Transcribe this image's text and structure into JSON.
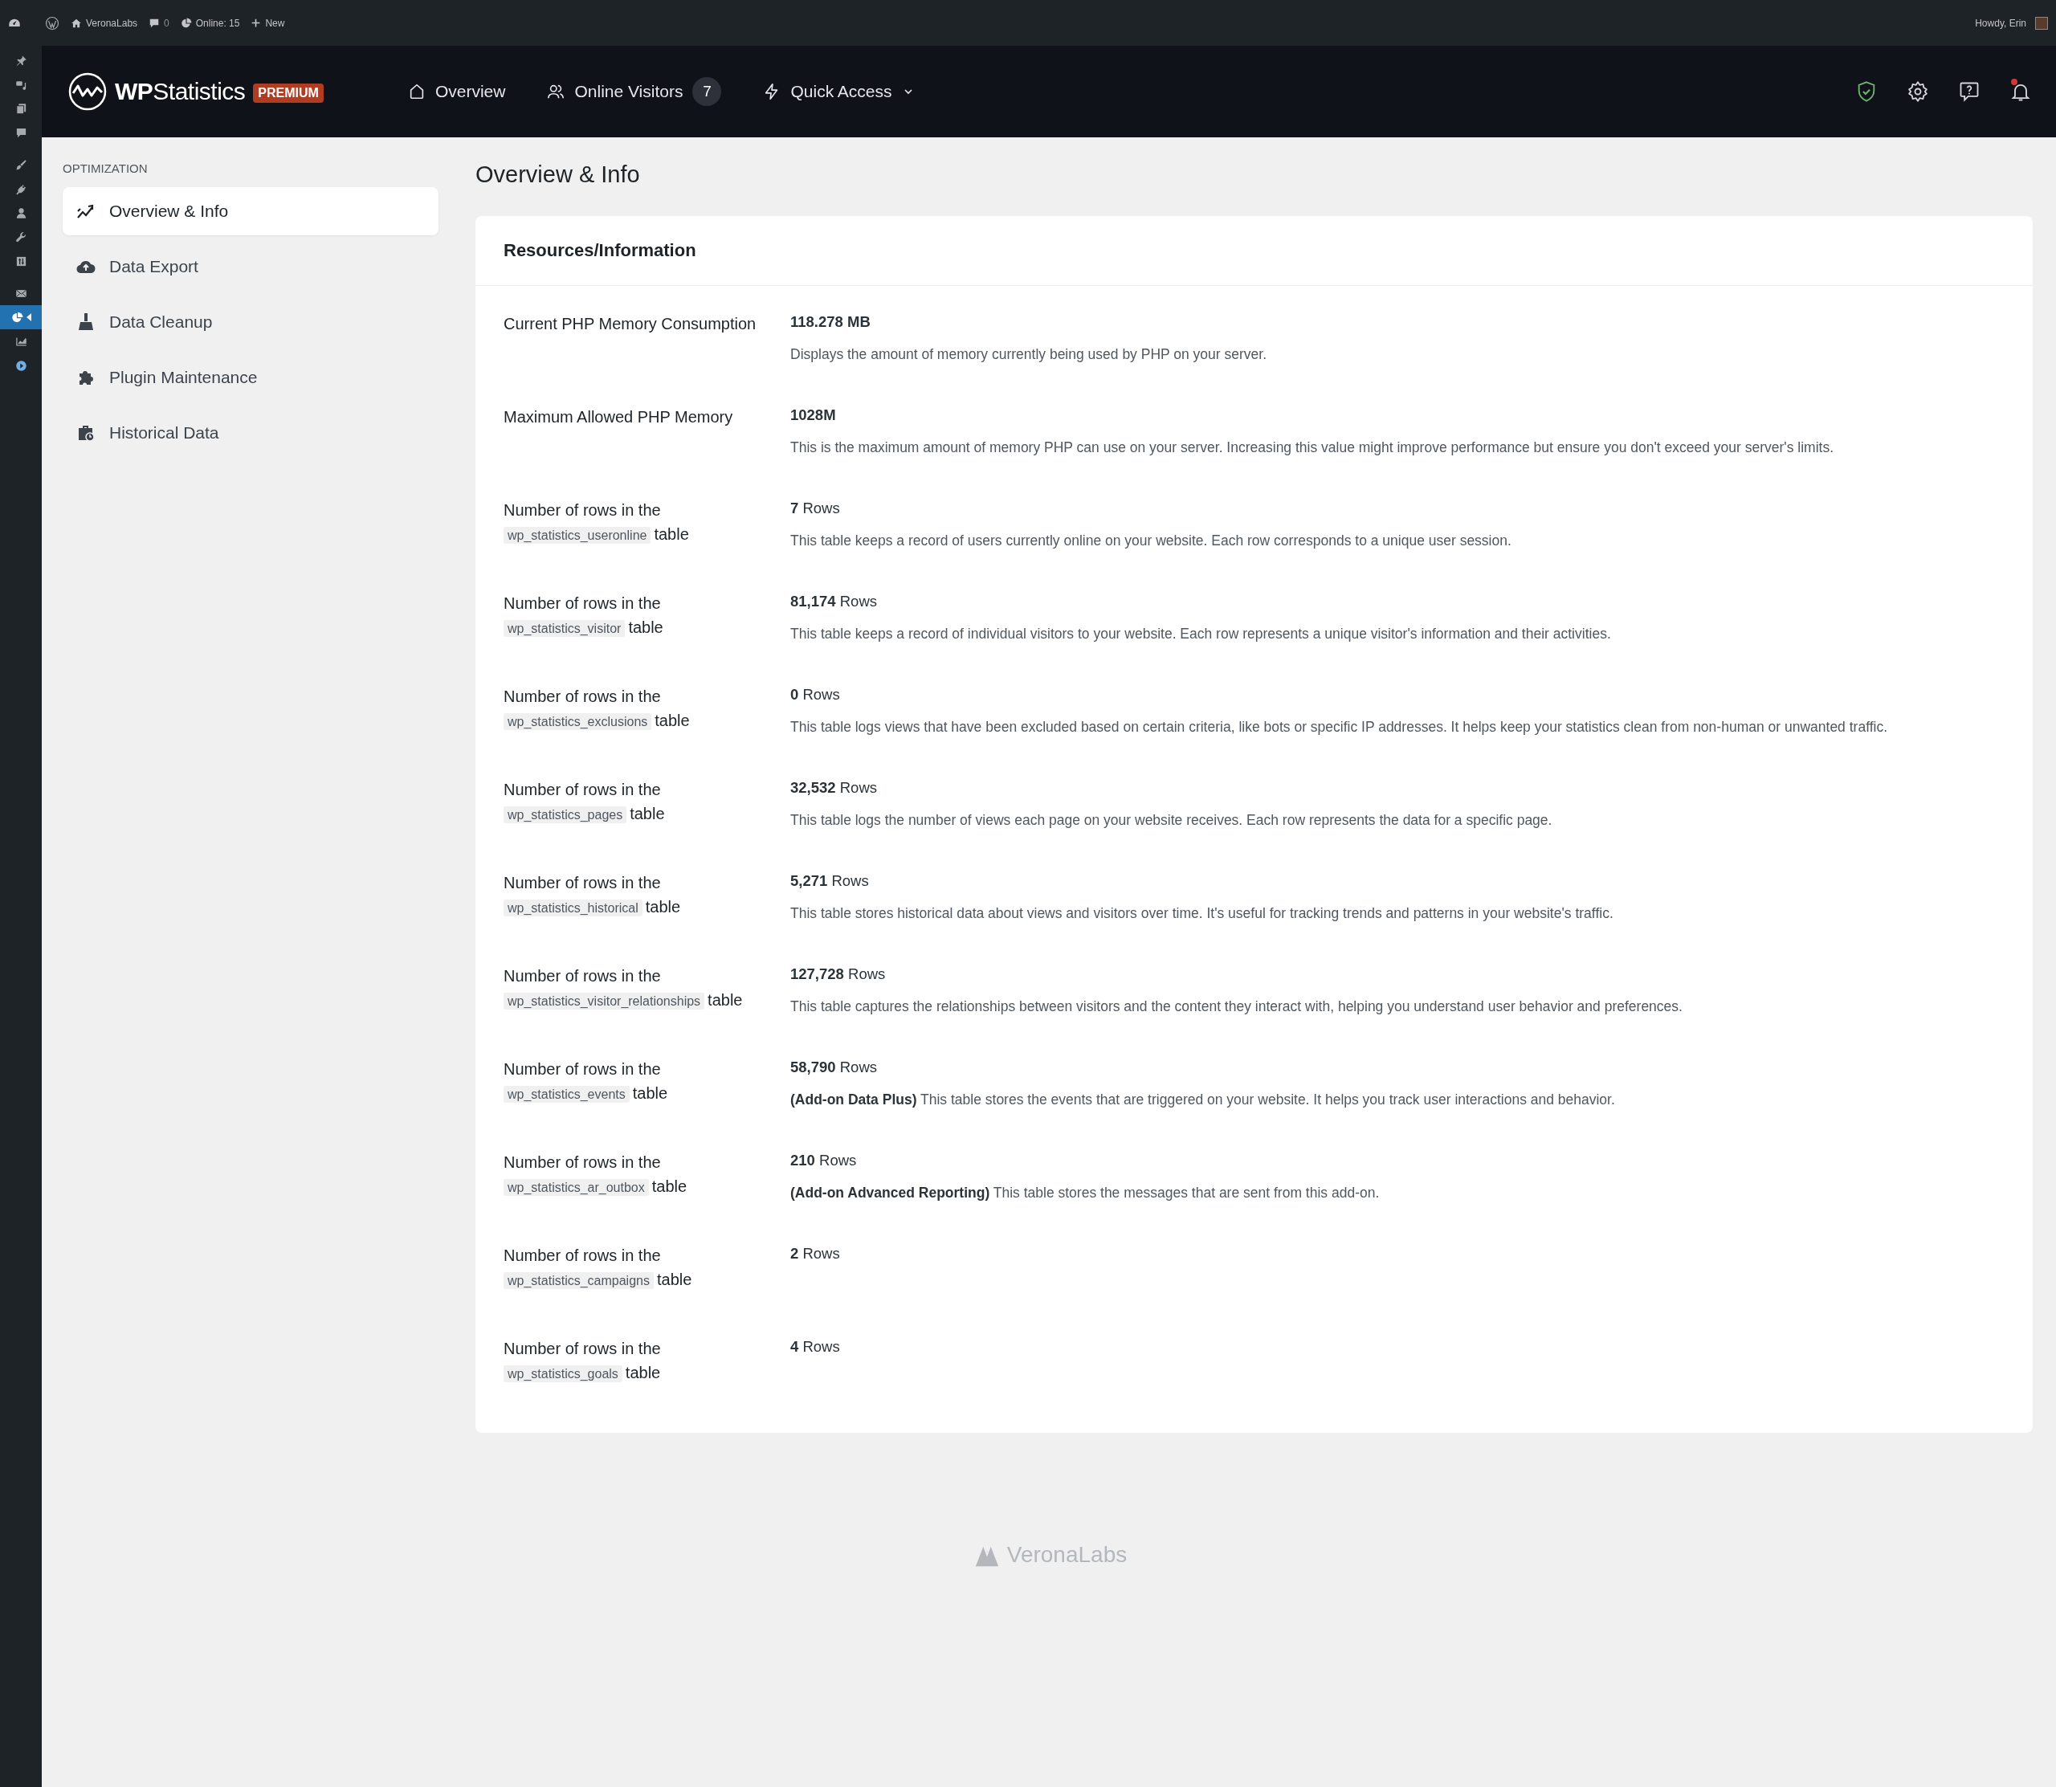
{
  "admin_bar": {
    "site": "VeronaLabs",
    "comments": "0",
    "online": "Online: 15",
    "new": "New",
    "greeting": "Howdy, Erin"
  },
  "admin_menu": [
    {
      "selected": false
    },
    {
      "selected": false
    },
    {
      "selected": false
    },
    {
      "selected": false
    },
    {
      "selected": false
    },
    {
      "selected": false
    },
    {
      "selected": false
    },
    {
      "selected": false
    },
    {
      "selected": false
    },
    {
      "selected": false
    },
    {
      "selected": true
    },
    {
      "selected": false
    },
    {
      "selected": false
    }
  ],
  "header": {
    "logo": "**WP**Statistics",
    "badge": "PREMIUM",
    "nav": [
      {
        "label": "Overview"
      },
      {
        "label": "Online Visitors",
        "count": "7"
      },
      {
        "label": "Quick Access",
        "dropdown": true
      }
    ],
    "has_notification": true
  },
  "sidebar": {
    "heading": "OPTIMIZATION",
    "items": [
      {
        "label": "Overview & Info",
        "selected": true
      },
      {
        "label": "Data Export",
        "selected": false
      },
      {
        "label": "Data Cleanup",
        "selected": false
      },
      {
        "label": "Plugin Maintenance",
        "selected": false
      },
      {
        "label": "Historical Data",
        "selected": false
      }
    ]
  },
  "page": {
    "title": "Overview & Info"
  },
  "card": {
    "title": "Resources/Information",
    "rows": [
      {
        "kind": "setting",
        "label": "Current PHP Memory Consumption",
        "value": "118.278 MB",
        "description": "Displays the amount of memory currently being used by PHP on your server."
      },
      {
        "kind": "setting",
        "label": "Maximum Allowed PHP Memory",
        "value": "1028M",
        "description": "This is the maximum amount of memory PHP can use on your server. Increasing this value might improve performance but ensure you don't exceed your server's limits."
      },
      {
        "kind": "table",
        "label": "Number of rows in the",
        "table_name": "wp_statistics_useronline",
        "suffix": "table",
        "count": "7",
        "unit": "Rows",
        "description": "This table keeps a record of users currently online on your website. Each row corresponds to a unique user session."
      },
      {
        "kind": "table",
        "label": "Number of rows in the",
        "table_name": "wp_statistics_visitor",
        "suffix": "table",
        "count": "81,174",
        "unit": "Rows",
        "description": "This table keeps a record of individual visitors to your website. Each row represents a unique visitor's information and their activities."
      },
      {
        "kind": "table",
        "label": "Number of rows in the",
        "table_name": "wp_statistics_exclusions",
        "suffix": "table",
        "count": "0",
        "unit": "Rows",
        "description": "This table logs views that have been excluded based on certain criteria, like bots or specific IP addresses. It helps keep your statistics clean from non-human or unwanted traffic."
      },
      {
        "kind": "table",
        "label": "Number of rows in the",
        "table_name": "wp_statistics_pages",
        "suffix": "table",
        "count": "32,532",
        "unit": "Rows",
        "description": "This table logs the number of views each page on your website receives. Each row represents the data for a specific page."
      },
      {
        "kind": "table",
        "label": "Number of rows in the",
        "table_name": "wp_statistics_historical",
        "suffix": "table",
        "count": "5,271",
        "unit": "Rows",
        "description": "This table stores historical data about views and visitors over time. It's useful for tracking trends and patterns in your website's traffic."
      },
      {
        "kind": "table",
        "label": "Number of rows in the",
        "table_name": "wp_statistics_visitor_relationships",
        "suffix": "table",
        "count": "127,728",
        "unit": "Rows",
        "description": "This table captures the relationships between visitors and the content they interact with, helping you understand user behavior and preferences."
      },
      {
        "kind": "table",
        "label": "Number of rows in the",
        "table_name": "wp_statistics_events",
        "suffix": "table",
        "count": "58,790",
        "unit": "Rows",
        "description": "**(Add-on Data Plus)** This table stores the events that are triggered on your website. It helps you track user interactions and behavior."
      },
      {
        "kind": "table",
        "label": "Number of rows in the",
        "table_name": "wp_statistics_ar_outbox",
        "suffix": "table",
        "count": "210",
        "unit": "Rows",
        "description": "**(Add-on Advanced Reporting)** This table stores the messages that are sent from this add-on."
      },
      {
        "kind": "table",
        "label": "Number of rows in the",
        "table_name": "wp_statistics_campaigns",
        "suffix": "table",
        "count": "2",
        "unit": "Rows"
      },
      {
        "kind": "table",
        "label": "Number of rows in the",
        "table_name": "wp_statistics_goals",
        "suffix": "table",
        "count": "4",
        "unit": "Rows"
      }
    ]
  },
  "footer": {
    "brand": "VeronaLabs"
  }
}
